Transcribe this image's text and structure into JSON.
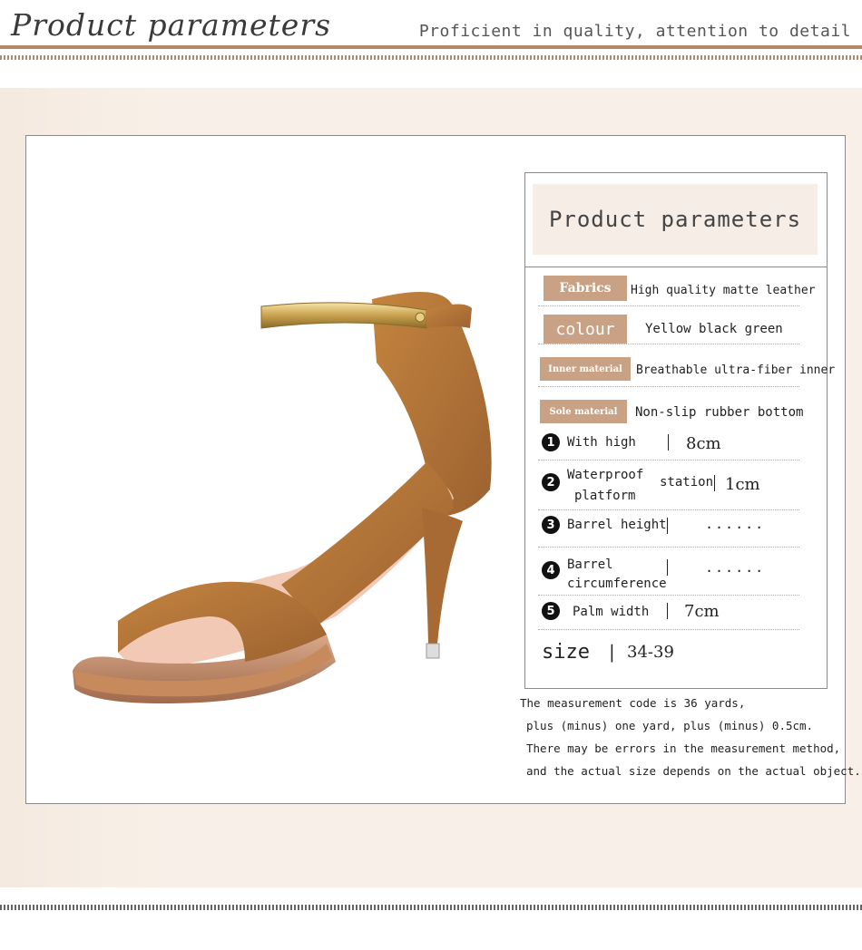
{
  "header": {
    "title": "Product parameters",
    "slogan": "Proficient in quality, attention to detail"
  },
  "spec": {
    "heading": "Product parameters",
    "tags": [
      {
        "label": "Fabrics",
        "value": "High quality matte leather"
      },
      {
        "label": "colour",
        "value": "Yellow black green"
      },
      {
        "label": "Inner material",
        "value": "Breathable ultra-fiber inner"
      },
      {
        "label": "Sole material",
        "value": "Non-slip rubber bottom"
      }
    ],
    "measures": [
      {
        "num": "1",
        "line1": "With high",
        "line2": "",
        "sep": "|",
        "value": "8cm"
      },
      {
        "num": "2",
        "line1": "Waterproof",
        "line2": "platform",
        "extra": "station",
        "sep": "|",
        "value": "1cm"
      },
      {
        "num": "3",
        "line1": "Barrel height",
        "line2": "",
        "sep": "|",
        "value": "......"
      },
      {
        "num": "4",
        "line1": "Barrel",
        "line2": "circumference",
        "sep": "|",
        "value": "......"
      },
      {
        "num": "5",
        "line1": "Palm width",
        "line2": "",
        "sep": "|",
        "value": "7cm"
      }
    ],
    "size_label": "size",
    "size_sep": "|",
    "size_value": "34-39"
  },
  "notes": [
    "The measurement code is 36 yards,",
    "plus (minus) one yard, plus (minus) 0.5cm.",
    "There may be errors in the measurement method,",
    "and the actual size depends on the actual object."
  ],
  "colors": {
    "accent": "#b38a6c",
    "tag": "#c9a184",
    "band": "#f8f0e8",
    "suede": "#b5773a"
  },
  "product_image": "tan suede open-toe ankle strap stiletto sandal with gold metal strap"
}
